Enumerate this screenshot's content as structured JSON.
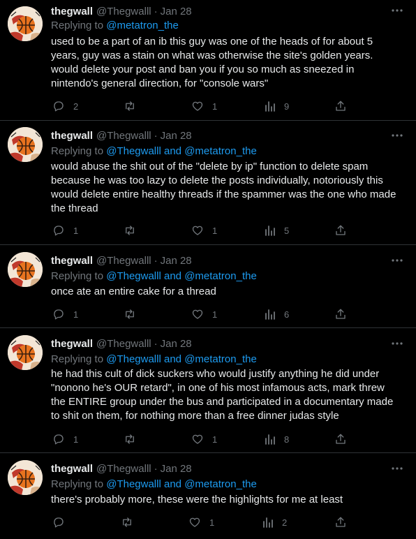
{
  "theme": {
    "background": "#000000",
    "text": "#e7e9ea",
    "muted": "#71767b",
    "accent": "#1d9bf0",
    "divider": "#2f3336"
  },
  "tweets": [
    {
      "name": "thegwall",
      "handle": "@Thegwalll",
      "date": "Jan 28",
      "replying_label": "Replying to",
      "mentions": [
        "@metatron_the"
      ],
      "joiner": "",
      "text": "used to be a part of an ib this guy was one of the heads of for about 5 years, guy was a stain on what was otherwise the site's golden years. would delete your post and ban you if you so much as sneezed in nintendo's general direction, for \"console wars\"",
      "replies": "2",
      "retweets": "",
      "likes": "1",
      "views": "9",
      "icons": [
        "avatar-icon",
        "more-options-icon",
        "reply-icon",
        "retweet-icon",
        "like-icon",
        "views-icon",
        "share-icon"
      ]
    },
    {
      "name": "thegwall",
      "handle": "@Thegwalll",
      "date": "Jan 28",
      "replying_label": "Replying to",
      "mentions": [
        "@Thegwalll",
        "@metatron_the"
      ],
      "joiner": "and",
      "text": "would abuse the shit out of the \"delete by ip\" function to delete spam because he was too lazy to delete the posts individually, notoriously this would delete entire healthy threads if the spammer was the one who made the thread",
      "replies": "1",
      "retweets": "",
      "likes": "1",
      "views": "5"
    },
    {
      "name": "thegwall",
      "handle": "@Thegwalll",
      "date": "Jan 28",
      "replying_label": "Replying to",
      "mentions": [
        "@Thegwalll",
        "@metatron_the"
      ],
      "joiner": "and",
      "text": "once ate an entire cake for a thread",
      "replies": "1",
      "retweets": "",
      "likes": "1",
      "views": "6"
    },
    {
      "name": "thegwall",
      "handle": "@Thegwalll",
      "date": "Jan 28",
      "replying_label": "Replying to",
      "mentions": [
        "@Thegwalll",
        "@metatron_the"
      ],
      "joiner": "and",
      "text": "he had this cult of dick suckers who would justify anything he did under \"nonono he's OUR retard\", in one of his most infamous acts, mark threw the ENTIRE group under the bus and participated in a documentary made to shit on them, for nothing more than a free dinner judas style",
      "replies": "1",
      "retweets": "",
      "likes": "1",
      "views": "8"
    },
    {
      "name": "thegwall",
      "handle": "@Thegwalll",
      "date": "Jan 28",
      "replying_label": "Replying to",
      "mentions": [
        "@Thegwalll",
        "@metatron_the"
      ],
      "joiner": "and",
      "text": "there's probably more, these were the highlights for me at least",
      "replies": "",
      "retweets": "",
      "likes": "1",
      "views": "2"
    }
  ]
}
